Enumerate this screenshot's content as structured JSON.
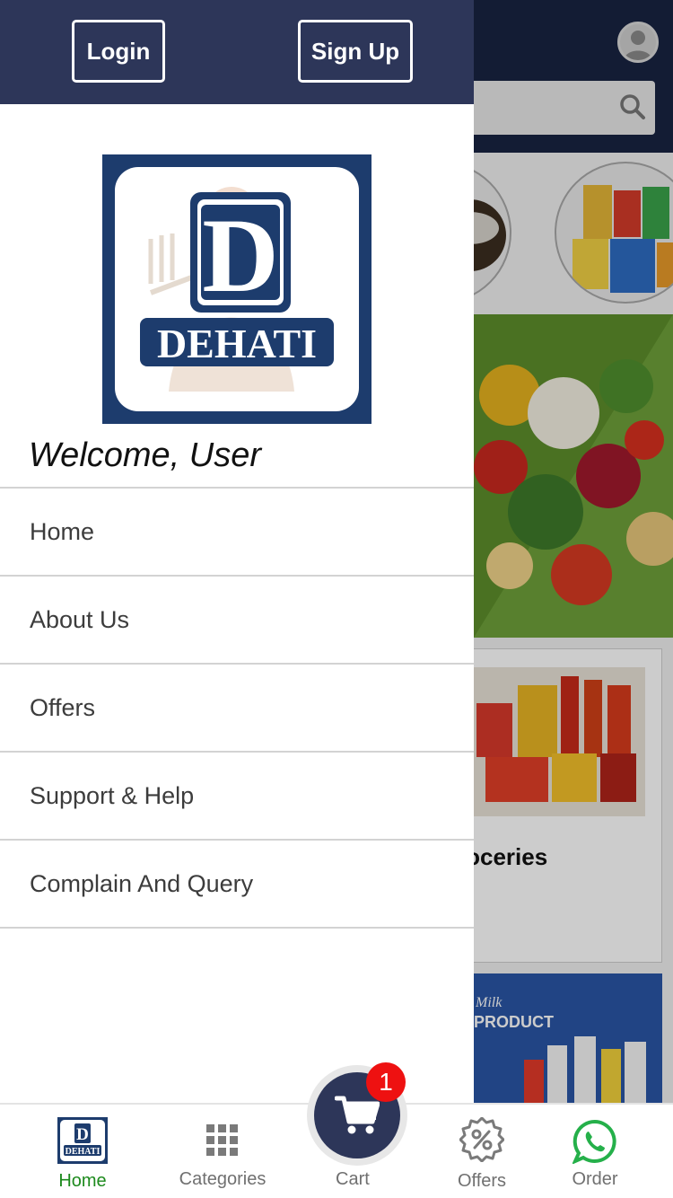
{
  "header": {
    "login_label": "Login",
    "signup_label": "Sign Up"
  },
  "logo": {
    "text": "DEHATI",
    "letter": "D"
  },
  "welcome_text": "Welcome, User",
  "menu": {
    "items": [
      {
        "label": "Home"
      },
      {
        "label": "About Us"
      },
      {
        "label": "Offers"
      },
      {
        "label": "Support & Help"
      },
      {
        "label": "Complain And Query"
      }
    ]
  },
  "background": {
    "category_title": "roceries",
    "milk_line1": "Milk",
    "milk_line2": "PRODUCT"
  },
  "bottom_nav": {
    "home_label": "Home",
    "categories_label": "Categories",
    "cart_label": "Cart",
    "cart_count": "1",
    "offers_label": "Offers",
    "order_label": "Order"
  },
  "colors": {
    "header_bg": "#2d3659",
    "accent_green": "#1d8a1d",
    "badge_red": "#ee1111",
    "logo_blue": "#1d3c6d",
    "whatsapp_green": "#25d366"
  },
  "icons": [
    "profile-icon",
    "search-icon",
    "dehati-logo",
    "grid-icon",
    "cart-icon",
    "discount-icon",
    "whatsapp-icon"
  ]
}
